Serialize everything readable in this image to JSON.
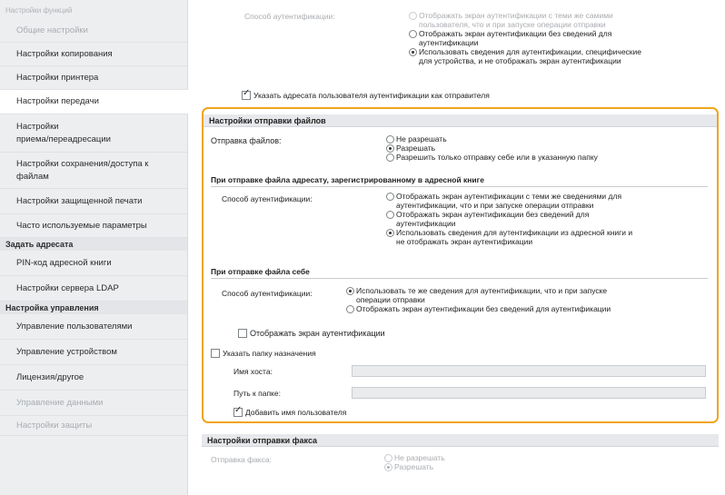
{
  "sidebar": {
    "header": "Настройки функций",
    "items": [
      {
        "label": "Общие настройки",
        "faded": true
      },
      {
        "label": "Настройки копирования"
      },
      {
        "label": "Настройки принтера"
      },
      {
        "label": "Настройки передачи",
        "active": true
      },
      {
        "label": "Настройки приема/переадресации",
        "lines": [
          "Настройки",
          "приема/переадресации"
        ]
      },
      {
        "label": "Настройки сохранения/доступа к файлам",
        "lines": [
          "Настройки сохранения/доступа к",
          "файлам"
        ]
      },
      {
        "label": "Настройки защищенной печати"
      },
      {
        "label": "Часто используемые параметры"
      }
    ],
    "section_addresses": "Задать адресата",
    "address_items": [
      {
        "label": "PIN-код адресной книги"
      },
      {
        "label": "Настройки сервера LDAP"
      }
    ],
    "section_management": "Настройка управления",
    "management_items": [
      {
        "label": "Управление пользователями"
      },
      {
        "label": "Управление устройством"
      },
      {
        "label": "Лицензия/другое"
      },
      {
        "label": "Управление данными",
        "faded": true
      },
      {
        "label": "Настройки защиты",
        "faded": true
      }
    ]
  },
  "top": {
    "auth_method_label": "Способ аутентификации:",
    "opt1": "Отображать экран аутентификации с теми же сведениями пользователя, что и при запуске операции отправки",
    "opt1_lines": [
      "Отображать экран аутентификации с теми же самими",
      "пользователя, что и при запуске операции отправки"
    ],
    "opt2_lines": [
      "Отображать экран аутентификации без сведений для",
      "аутентификации"
    ],
    "opt3_lines": [
      "Использовать сведения для аутентификации, специфические",
      "для устройства, и не отображать экран аутентификации"
    ],
    "sender_checkbox": "Указать адресата пользователя аутентификации как отправителя"
  },
  "file_settings": {
    "title": "Настройки отправки файлов",
    "send_files_label": "Отправка файлов:",
    "send_options": [
      "Не разрешать",
      "Разрешать",
      "Разрешить только отправку себе или в указанную папку"
    ],
    "address_book_heading": "При отправке файла адресату, зарегистрированному в адресной книге",
    "auth_label": "Способ аутентификации:",
    "ab_opt1_lines": [
      "Отображать экран аутентификации с теми же сведениями для",
      "аутентификации, что и при запуске операции отправки"
    ],
    "ab_opt2_lines": [
      "Отображать экран аутентификации без сведений для",
      "аутентификации"
    ],
    "ab_opt3_lines": [
      "Использовать сведения для аутентификации из адресной книги и",
      "не отображать экран аутентификации"
    ],
    "self_heading": "При отправке файла себе",
    "self_auth_label": "Способ аутентификации:",
    "self_opt1_lines": [
      "Использовать те же сведения для аутентификации, что и при запуске",
      "операции отправки"
    ],
    "self_opt2": "Отображать экран аутентификации без сведений для аутентификации",
    "show_auth_checkbox": "Отображать экран аутентификации",
    "dest_folder_checkbox": "Указать папку назначения",
    "host_label": "Имя хоста:",
    "host_value": "",
    "path_label": "Путь к папке:",
    "path_value": "",
    "add_username_checkbox": "Добавить имя пользователя"
  },
  "fax_settings": {
    "title": "Настройки отправки факса",
    "send_fax_label": "Отправка факса:",
    "options": [
      "Не разрешать",
      "Разрешать"
    ]
  },
  "colors": {
    "highlight": "#f0a41a",
    "sidebar_bg": "#eceef0"
  }
}
